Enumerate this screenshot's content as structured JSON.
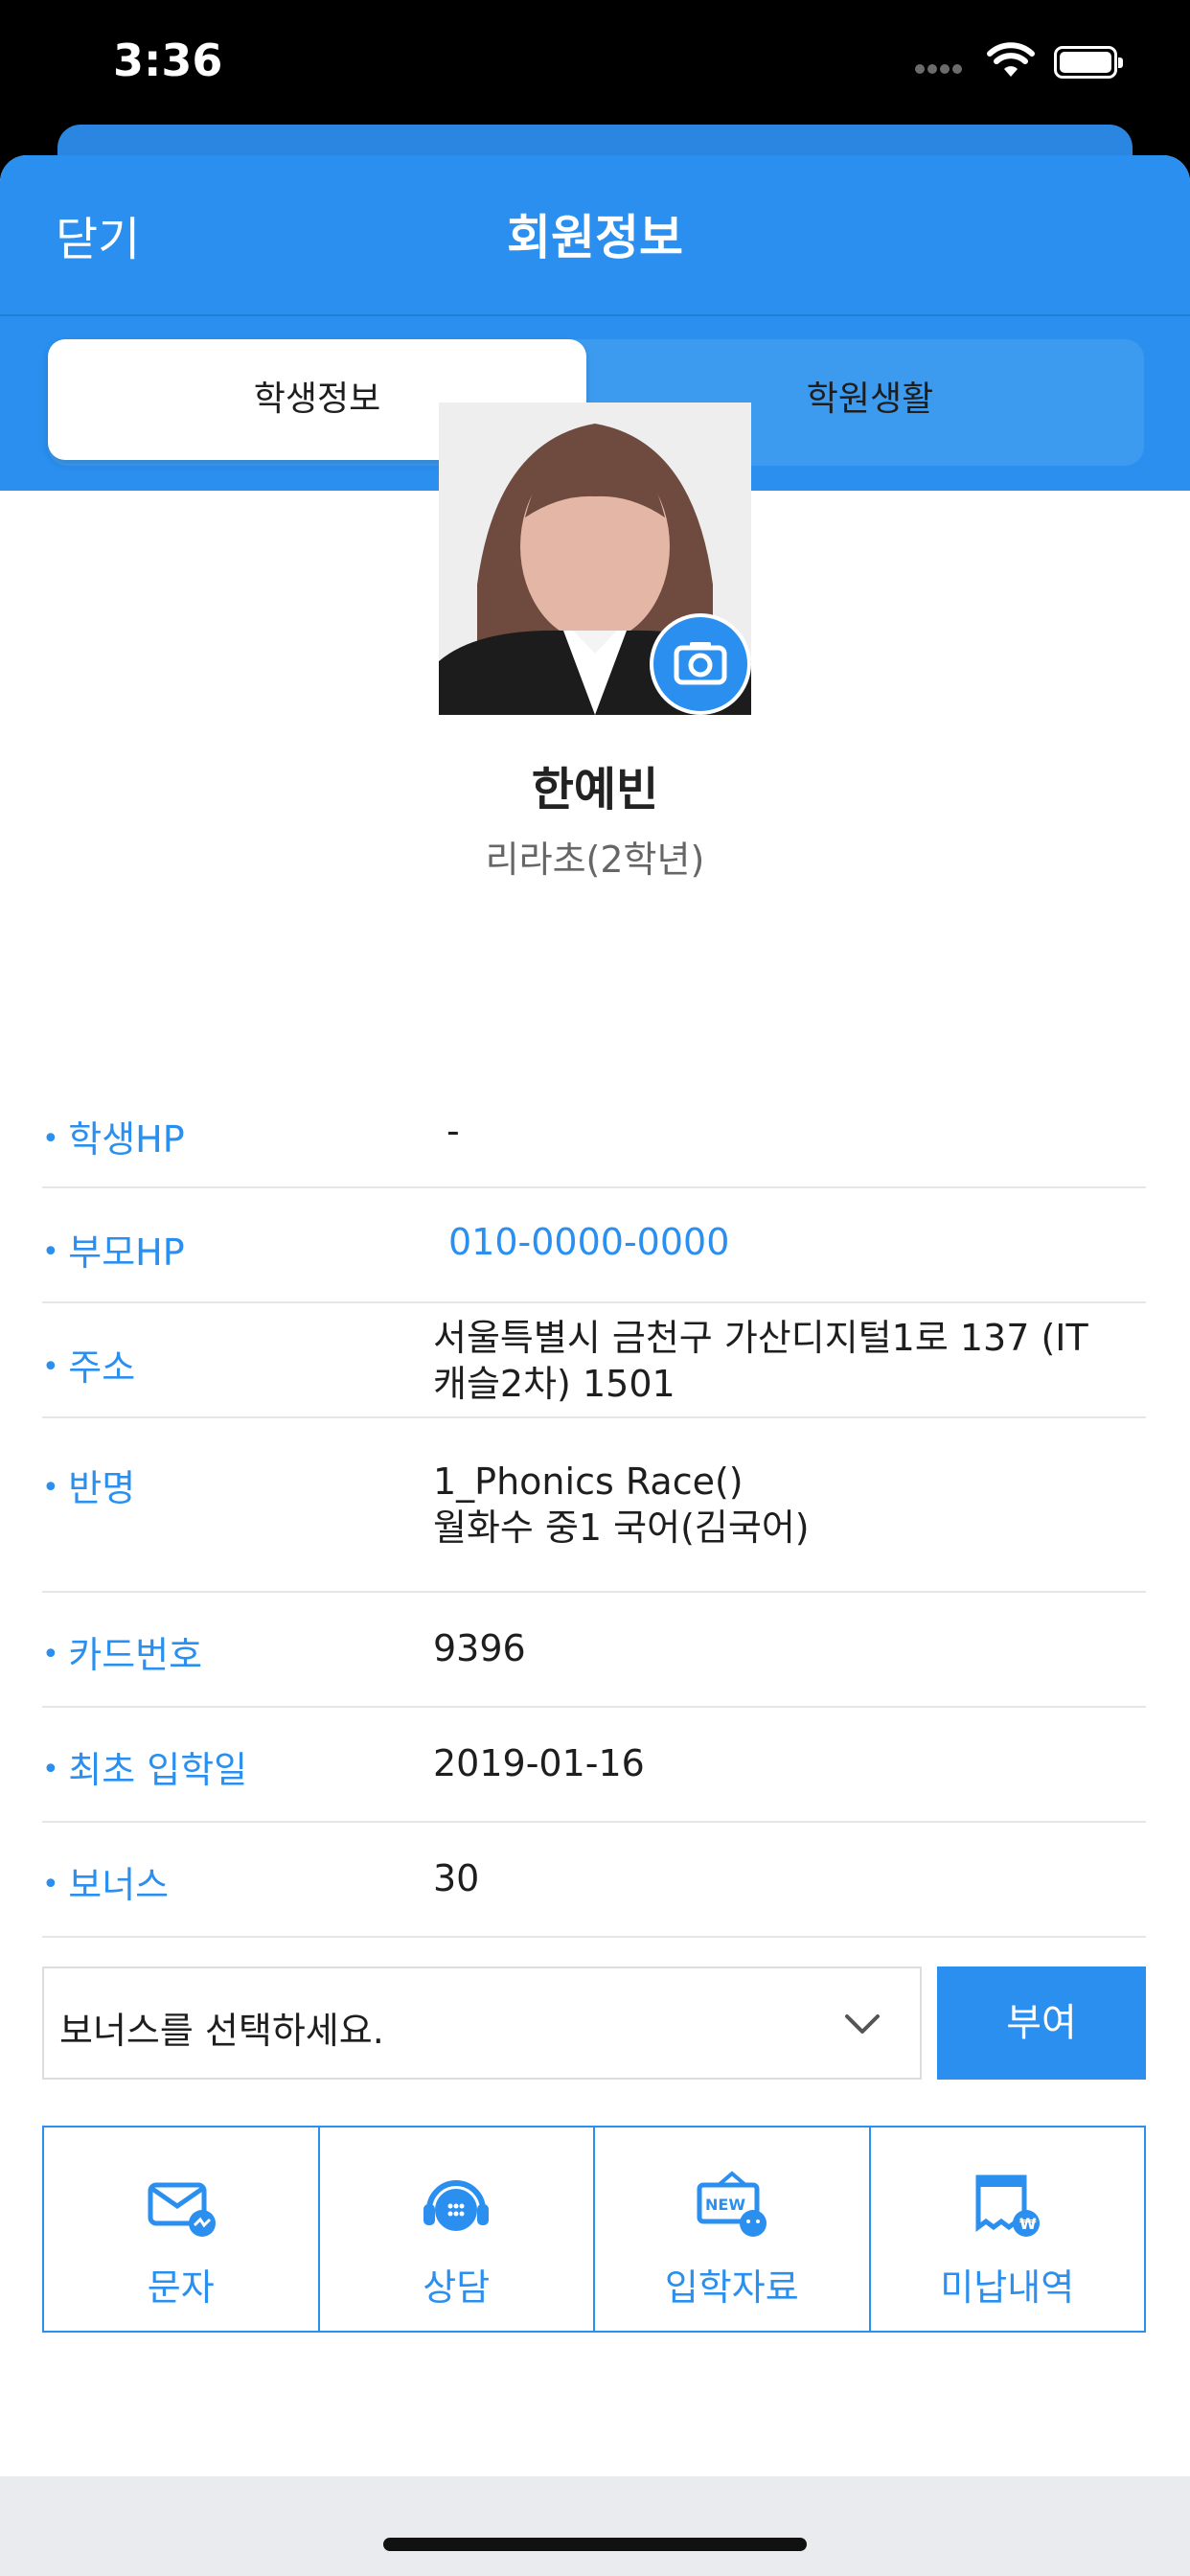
{
  "status_bar": {
    "time": "3:36"
  },
  "header": {
    "close_label": "닫기",
    "title": "회원정보"
  },
  "tabs": [
    {
      "label": "학생정보",
      "active": true
    },
    {
      "label": "학원생활",
      "active": false
    }
  ],
  "profile": {
    "name": "한예빈",
    "subtitle": "리라초(2학년)"
  },
  "info": [
    {
      "label": "학생HP",
      "value": "-"
    },
    {
      "label": "부모HP",
      "value": "010-0000-0000"
    },
    {
      "label": "주소",
      "value_line1": "서울특별시 금천구 가산디지털1로 137 (IT",
      "value_line2": "캐슬2차) 1501"
    },
    {
      "label": "반명",
      "value_line1": "1_Phonics Race()",
      "value_line2": "월화수 중1 국어(김국어)"
    },
    {
      "label": "카드번호",
      "value": "9396"
    },
    {
      "label": "최초 입학일",
      "value": "2019-01-16"
    },
    {
      "label": "보너스",
      "value": "30"
    }
  ],
  "bonus": {
    "select_placeholder": "보너스를 선택하세요.",
    "grant_label": "부여"
  },
  "actions": [
    {
      "label": "문자",
      "icon": "message-icon"
    },
    {
      "label": "상담",
      "icon": "headset-icon"
    },
    {
      "label": "입학자료",
      "icon": "new-badge-icon"
    },
    {
      "label": "미납내역",
      "icon": "receipt-won-icon"
    }
  ],
  "colors": {
    "primary": "#2a8fef",
    "text": "#1e1e1e"
  }
}
